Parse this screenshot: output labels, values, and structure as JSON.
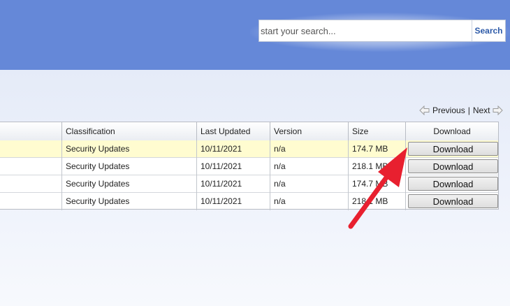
{
  "search": {
    "placeholder": "start your search...",
    "button_label": "Search"
  },
  "pager": {
    "previous_label": "Previous",
    "separator": "|",
    "next_label": "Next"
  },
  "table": {
    "columns": [
      "",
      "Classification",
      "Last Updated",
      "Version",
      "Size",
      "Download"
    ],
    "rows": [
      {
        "classification": "Security Updates",
        "last_updated": "10/11/2021",
        "version": "n/a",
        "size": "174.7 MB",
        "download_label": "Download",
        "highlighted": true
      },
      {
        "classification": "Security Updates",
        "last_updated": "10/11/2021",
        "version": "n/a",
        "size": "218.1 MB",
        "download_label": "Download",
        "highlighted": false
      },
      {
        "classification": "Security Updates",
        "last_updated": "10/11/2021",
        "version": "n/a",
        "size": "174.7 MB",
        "download_label": "Download",
        "highlighted": false
      },
      {
        "classification": "Security Updates",
        "last_updated": "10/11/2021",
        "version": "n/a",
        "size": "218.1 MB",
        "download_label": "Download",
        "highlighted": false
      }
    ]
  },
  "colors": {
    "header_band": "#6588d8",
    "highlight_row": "#fffcd0",
    "annotation_arrow": "#e8202f"
  },
  "icons": [
    "arrow-left-icon",
    "arrow-right-icon"
  ]
}
